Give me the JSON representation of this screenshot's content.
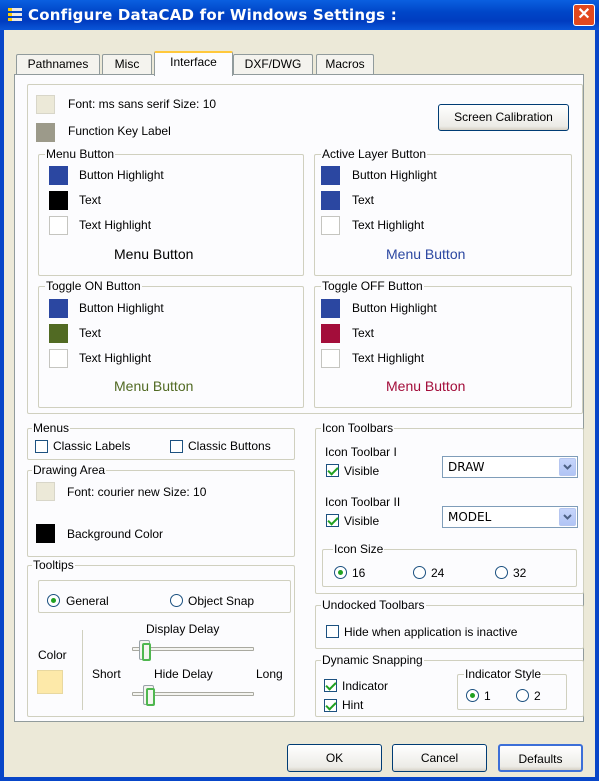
{
  "window": {
    "title": "Configure DataCAD for Windows Settings :",
    "close_label": "✕"
  },
  "tabs": [
    {
      "label": "Pathnames"
    },
    {
      "label": "Misc"
    },
    {
      "label": "Interface",
      "active": true
    },
    {
      "label": "DXF/DWG"
    },
    {
      "label": "Macros"
    }
  ],
  "font_info": {
    "label": "Font: ms sans serif  Size: 10",
    "function_key_label": "Function Key Label",
    "screen_calibration": "Screen Calibration"
  },
  "menu_button": {
    "title": "Menu Button",
    "button_highlight": "Button Highlight",
    "text": "Text",
    "text_highlight": "Text Highlight",
    "preview": "Menu Button",
    "colors": {
      "button_highlight": "#2b47a1",
      "text": "#000000",
      "text_highlight": "#ffffff"
    }
  },
  "active_layer_button": {
    "title": "Active Layer Button",
    "button_highlight": "Button Highlight",
    "text": "Text",
    "text_highlight": "Text Highlight",
    "preview": "Menu Button",
    "colors": {
      "button_highlight": "#2b47a1",
      "text": "#2b47a1",
      "text_highlight": "#ffffff"
    }
  },
  "toggle_on_button": {
    "title": "Toggle ON Button",
    "button_highlight": "Button Highlight",
    "text": "Text",
    "text_highlight": "Text Highlight",
    "preview": "Menu Button",
    "colors": {
      "button_highlight": "#2b47a1",
      "text": "#516a23",
      "text_highlight": "#ffffff"
    }
  },
  "toggle_off_button": {
    "title": "Toggle OFF Button",
    "button_highlight": "Button Highlight",
    "text": "Text",
    "text_highlight": "Text Highlight",
    "preview": "Menu Button",
    "colors": {
      "button_highlight": "#2b47a1",
      "text": "#a30d3a",
      "text_highlight": "#ffffff"
    }
  },
  "menus": {
    "title": "Menus",
    "classic_labels": "Classic Labels",
    "classic_buttons": "Classic Buttons"
  },
  "drawing_area": {
    "title": "Drawing Area",
    "font": "Font: courier new  Size: 10",
    "background_color": "Background Color"
  },
  "tooltips": {
    "title": "Tooltips",
    "general": "General",
    "object_snap": "Object Snap",
    "selected": "General",
    "color_label": "Color",
    "display_delay": "Display Delay",
    "short": "Short",
    "hide_delay": "Hide Delay",
    "long": "Long",
    "display_delay_value": 0.02,
    "hide_delay_value": 0.1,
    "color": "#fde9a9"
  },
  "icon_toolbars": {
    "title": "Icon Toolbars",
    "toolbar1_label": "Icon Toolbar I",
    "toolbar1_visible": "Visible",
    "toolbar1_value": "DRAW",
    "toolbar2_label": "Icon Toolbar II",
    "toolbar2_visible": "Visible",
    "toolbar2_value": "MODEL",
    "icon_size_title": "Icon Size",
    "sizes": [
      "16",
      "24",
      "32"
    ],
    "selected_size": "16"
  },
  "undocked_toolbars": {
    "title": "Undocked Toolbars",
    "hide_inactive": "Hide when application is inactive"
  },
  "dynamic_snapping": {
    "title": "Dynamic Snapping",
    "indicator": "Indicator",
    "hint": "Hint",
    "indicator_style_title": "Indicator Style",
    "style1": "1",
    "style2": "2",
    "selected_style": "1"
  },
  "footer": {
    "ok": "OK",
    "cancel": "Cancel",
    "defaults": "Defaults"
  }
}
